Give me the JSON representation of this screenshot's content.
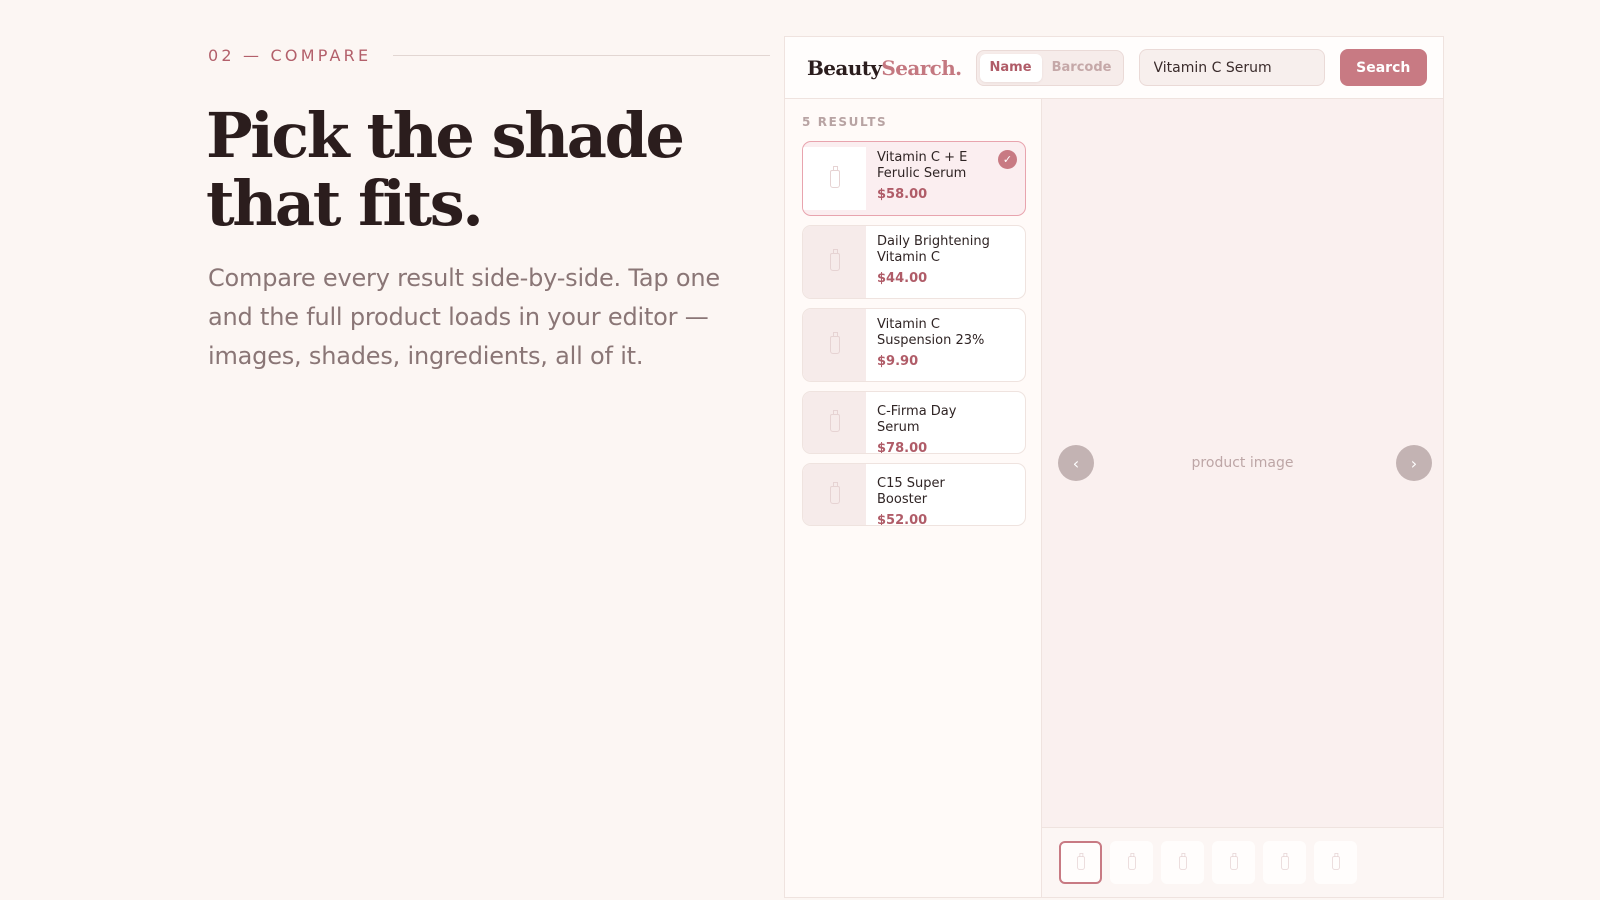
{
  "intro": {
    "eyebrow": "02 — COMPARE",
    "headline_line1": "Pick the shade",
    "headline_line2": "that fits.",
    "lede": "Compare every result side-by-side. Tap one and the full product loads in your editor — images, shades, ingredients, all of it."
  },
  "app": {
    "logo_main": "Beauty",
    "logo_accent": "Search.",
    "mode_toggle": {
      "active": "Name",
      "inactive": "Barcode"
    },
    "search": {
      "value": "Vitamin C Serum",
      "button": "Search"
    },
    "results_count": "5 RESULTS",
    "results": [
      {
        "title": "Vitamin C + E Ferulic Serum",
        "price": "$58.00",
        "selected": true
      },
      {
        "title": "Daily Brightening Vitamin C",
        "price": "$44.00",
        "selected": false
      },
      {
        "title": "Vitamin C Suspension 23%",
        "price": "$9.90",
        "selected": false
      },
      {
        "title": "C-Firma Day Serum",
        "price": "$78.00",
        "selected": false
      },
      {
        "title": "C15 Super Booster",
        "price": "$52.00",
        "selected": false
      }
    ],
    "preview": {
      "placeholder": "product image",
      "prev_arrow": "‹",
      "next_arrow": "›",
      "thumbnail_count": 6,
      "active_thumbnail": 1
    },
    "icons": {
      "check": "check-icon",
      "product": "bottle-icon"
    },
    "colors": {
      "accent": "#c87a83",
      "price": "#b05c68",
      "background": "#fcf6f3"
    }
  }
}
